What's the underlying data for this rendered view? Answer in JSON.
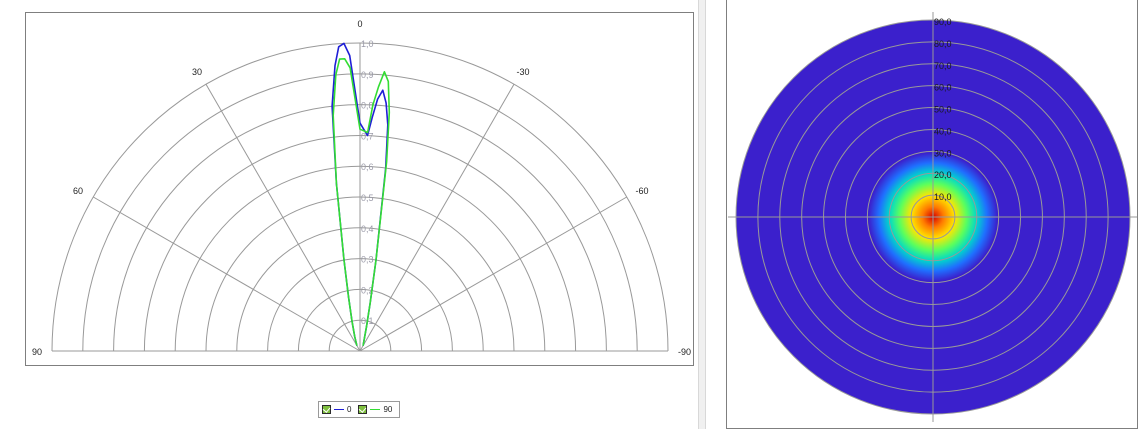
{
  "chart_data": [
    {
      "type": "polar-line",
      "angle_labels": [
        "0",
        "30",
        "-30",
        "60",
        "-60",
        "90",
        "-90"
      ],
      "radial_ticks": [
        "0,1",
        "0,2",
        "0,3",
        "0,4",
        "0,5",
        "0,6",
        "0,7",
        "0,8",
        "0,9",
        "1,0"
      ],
      "rlim": [
        0,
        1.0
      ],
      "theta_range": [
        -90,
        90
      ],
      "series": [
        {
          "name": "0",
          "color": "#1f1fd6",
          "points": [
            [
              -30,
              0.02
            ],
            [
              -20,
              0.05
            ],
            [
              -15,
              0.1
            ],
            [
              -12,
              0.18
            ],
            [
              -10,
              0.3
            ],
            [
              -8,
              0.55
            ],
            [
              -6.5,
              0.8
            ],
            [
              -5,
              0.93
            ],
            [
              -4,
              0.99
            ],
            [
              -3,
              1.0
            ],
            [
              -2,
              0.96
            ],
            [
              0,
              0.74
            ],
            [
              2,
              0.7
            ],
            [
              3,
              0.76
            ],
            [
              4,
              0.82
            ],
            [
              5,
              0.85
            ],
            [
              6,
              0.81
            ],
            [
              7,
              0.74
            ],
            [
              8,
              0.6
            ],
            [
              10,
              0.3
            ],
            [
              12,
              0.16
            ],
            [
              15,
              0.08
            ],
            [
              20,
              0.04
            ],
            [
              30,
              0.02
            ]
          ]
        },
        {
          "name": "90",
          "color": "#33dd33",
          "points": [
            [
              -30,
              0.02
            ],
            [
              -20,
              0.05
            ],
            [
              -15,
              0.1
            ],
            [
              -12,
              0.18
            ],
            [
              -10,
              0.3
            ],
            [
              -8,
              0.55
            ],
            [
              -6.5,
              0.77
            ],
            [
              -5,
              0.9
            ],
            [
              -4,
              0.95
            ],
            [
              -3,
              0.95
            ],
            [
              -2,
              0.92
            ],
            [
              0,
              0.72
            ],
            [
              2,
              0.71
            ],
            [
              3,
              0.8
            ],
            [
              4,
              0.86
            ],
            [
              5,
              0.91
            ],
            [
              6,
              0.88
            ],
            [
              7,
              0.78
            ],
            [
              8,
              0.62
            ],
            [
              10,
              0.3
            ],
            [
              12,
              0.16
            ],
            [
              15,
              0.08
            ],
            [
              20,
              0.04
            ],
            [
              30,
              0.02
            ]
          ]
        }
      ],
      "legend": [
        "0",
        "90"
      ],
      "legend_position": "bottom-center",
      "grid": true
    },
    {
      "type": "heatmap",
      "projection": "polar",
      "ring_labels": [
        "90,0",
        "80,0",
        "70,0",
        "60,0",
        "50,0",
        "40,0",
        "30,0",
        "20,0",
        "10,0"
      ],
      "rlim": [
        0,
        90
      ],
      "hotspot_center": [
        0,
        0
      ],
      "hotspot_extent": 12,
      "colormap": [
        "#d40000",
        "#ff7a00",
        "#ffe600",
        "#5cff5c",
        "#00d9c8",
        "#1f6fff",
        "#3b20cc"
      ],
      "grid": true
    }
  ],
  "colors": {
    "grid": "#999999",
    "axis": "#7a7a7a",
    "background_disc": "#3b20cc",
    "label_text": "#222222"
  },
  "legend_items": [
    {
      "label": "0",
      "color": "#1f1fd6"
    },
    {
      "label": "90",
      "color": "#33dd33"
    }
  ]
}
